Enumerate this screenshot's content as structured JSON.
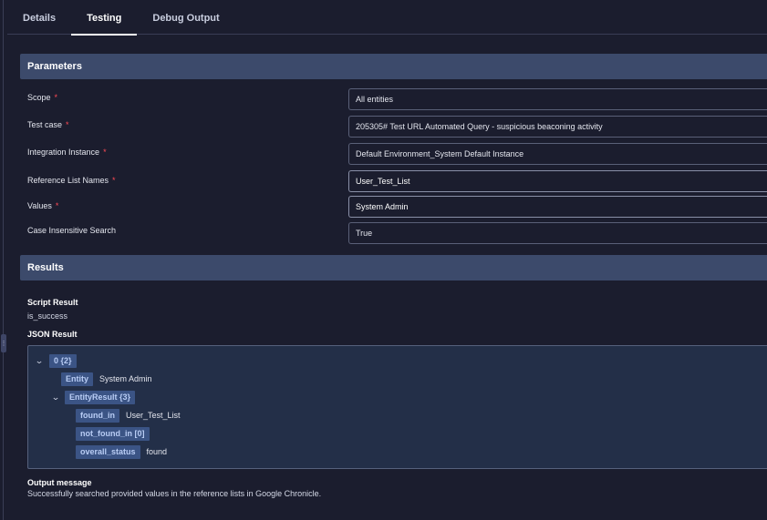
{
  "tabs": [
    {
      "label": "Details"
    },
    {
      "label": "Testing"
    },
    {
      "label": "Debug Output"
    }
  ],
  "parameters": {
    "header": "Parameters",
    "fields": [
      {
        "label": "Scope",
        "value": "All entities"
      },
      {
        "label": "Test case",
        "value": "205305# Test URL Automated Query - suspicious beaconing activity"
      },
      {
        "label": "Integration Instance",
        "value": "Default Environment_System Default Instance"
      },
      {
        "label": "Reference List Names",
        "value": "User_Test_List"
      },
      {
        "label": "Values",
        "value": "System Admin"
      },
      {
        "label": "Case Insensitive Search",
        "value": "True"
      }
    ],
    "required_mark": "*"
  },
  "results": {
    "header": "Results",
    "script_result_label": "Script Result",
    "script_result_value": "is_success",
    "json_result_label": "JSON Result",
    "json_tree": {
      "root_key": "0 {2}",
      "entity_key": "Entity",
      "entity_value": "System Admin",
      "entity_result_key": "EntityResult {3}",
      "found_in_key": "found_in",
      "found_in_value": "User_Test_List",
      "not_found_in_key": "not_found_in [0]",
      "overall_status_key": "overall_status",
      "overall_status_value": "found"
    },
    "output_message_label": "Output message",
    "output_message_value": "Successfully searched provided values in the reference lists in Google Chronicle."
  },
  "icons": {
    "chevron": "⌄",
    "rail_handle": "⋮"
  },
  "colors": {
    "background": "#1b1d2e",
    "section_header": "#3c4a6b",
    "json_panel": "#232f48",
    "key_chip": "#3b5485",
    "required": "#ff4b55"
  }
}
